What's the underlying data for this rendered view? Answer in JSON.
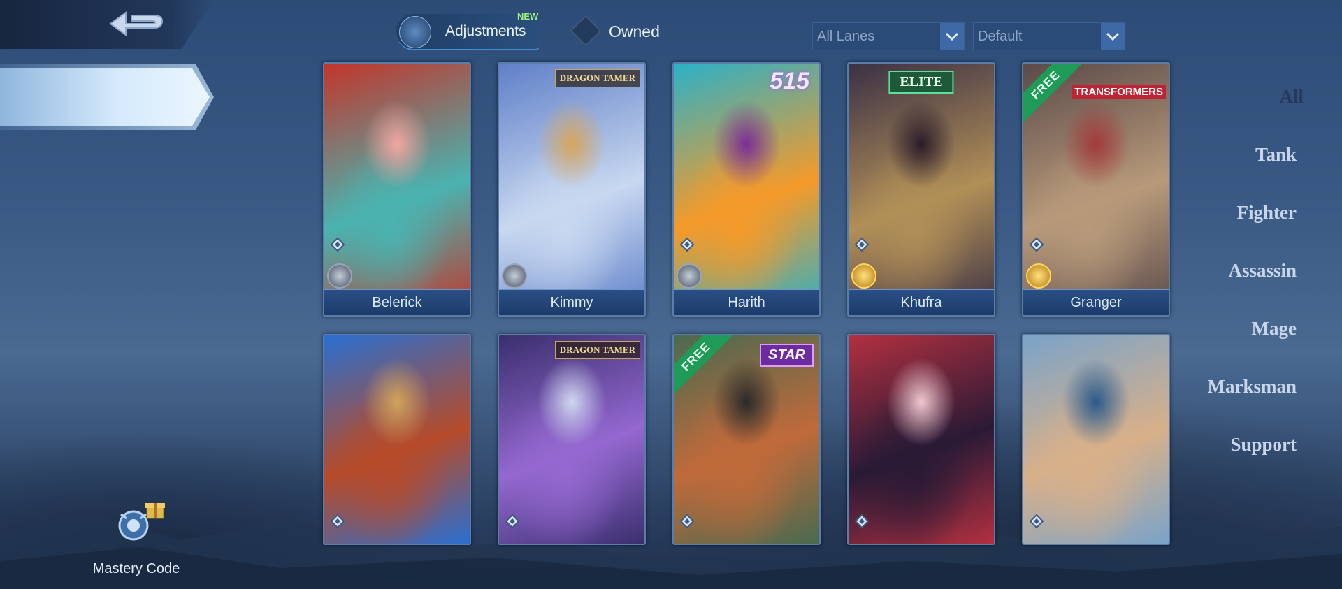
{
  "nav": {
    "back_icon": "back-arrow-icon"
  },
  "sidebar": {
    "items": [
      {
        "label": "All",
        "active": true
      },
      {
        "label": "Tank"
      },
      {
        "label": "Fighter"
      },
      {
        "label": "Assassin"
      },
      {
        "label": "Mage"
      },
      {
        "label": "Marksman"
      },
      {
        "label": "Support"
      }
    ],
    "mastery_label": "Mastery Code"
  },
  "topbar": {
    "adjustments_label": "Adjustments",
    "new_badge": "NEW",
    "owned_label": "Owned",
    "lane_filter": "All Lanes",
    "sort_filter": "Default"
  },
  "heroes": [
    {
      "name": "Belerick",
      "colors": [
        "#c3352a",
        "#4ab3b0",
        "#f2a6a0"
      ],
      "badge": ""
    },
    {
      "name": "Kimmy",
      "colors": [
        "#5f7fc8",
        "#c8d8f0",
        "#d7a65d"
      ],
      "badge": "DRAGON TAMER"
    },
    {
      "name": "Harith",
      "colors": [
        "#2bb1c7",
        "#f59a2a",
        "#7a2e95"
      ],
      "badge": "515"
    },
    {
      "name": "Khufra",
      "colors": [
        "#3b3045",
        "#b18f57",
        "#2b1c2a"
      ],
      "badge": "ELITE"
    },
    {
      "name": "Granger",
      "colors": [
        "#5a4a4a",
        "#b89a7a",
        "#a23a3a"
      ],
      "badge": "TRANSFORMERS",
      "free": "FREE"
    },
    {
      "name": "",
      "colors": [
        "#2a6fd0",
        "#b64b2a",
        "#d0a45c"
      ],
      "badge": ""
    },
    {
      "name": "",
      "colors": [
        "#3a2f6e",
        "#9468d0",
        "#cfd7ef"
      ],
      "badge": "DRAGON TAMER"
    },
    {
      "name": "",
      "colors": [
        "#4a6a50",
        "#c06a3a",
        "#2a2a2a"
      ],
      "badge": "STAR",
      "free": "FREE"
    },
    {
      "name": "",
      "colors": [
        "#b23040",
        "#2a1a35",
        "#f0c8d0"
      ],
      "badge": ""
    },
    {
      "name": "",
      "colors": [
        "#7aa3c9",
        "#d8b08a",
        "#2a5a8a"
      ],
      "badge": ""
    }
  ]
}
